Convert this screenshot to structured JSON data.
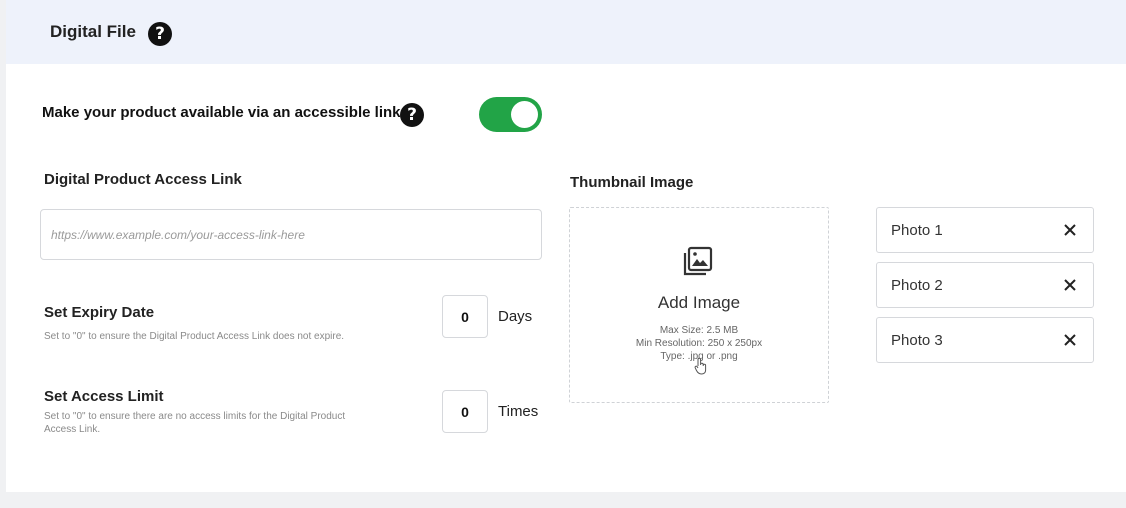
{
  "header": {
    "title": "Digital File",
    "help_glyph": "?"
  },
  "availability": {
    "label": "Make your product available via an accessible link",
    "help_glyph": "?",
    "toggle_on": true,
    "toggle_color": "#22a447"
  },
  "access_link": {
    "label": "Digital Product Access Link",
    "placeholder": "https://www.example.com/your-access-link-here",
    "value": ""
  },
  "expiry": {
    "title": "Set Expiry Date",
    "help": "Set to \"0\" to ensure the Digital Product Access Link does not expire.",
    "value": "0",
    "unit": "Days"
  },
  "access_limit": {
    "title": "Set Access Limit",
    "help_line1": "Set to \"0\" to ensure there are no access limits for the Digital Product",
    "help_line2": "Access Link.",
    "value": "0",
    "unit": "Times"
  },
  "thumbnail": {
    "label": "Thumbnail Image",
    "add_label": "Add Image",
    "max_size": "Max Size: 2.5 MB",
    "min_resolution": "Min Resolution: 250 x 250px",
    "type": "Type: .jpg or .png",
    "icon": "image-gallery-icon"
  },
  "photos": [
    {
      "label": "Photo 1",
      "icon": "close-icon"
    },
    {
      "label": "Photo 2",
      "icon": "close-icon"
    },
    {
      "label": "Photo 3",
      "icon": "close-icon"
    }
  ]
}
